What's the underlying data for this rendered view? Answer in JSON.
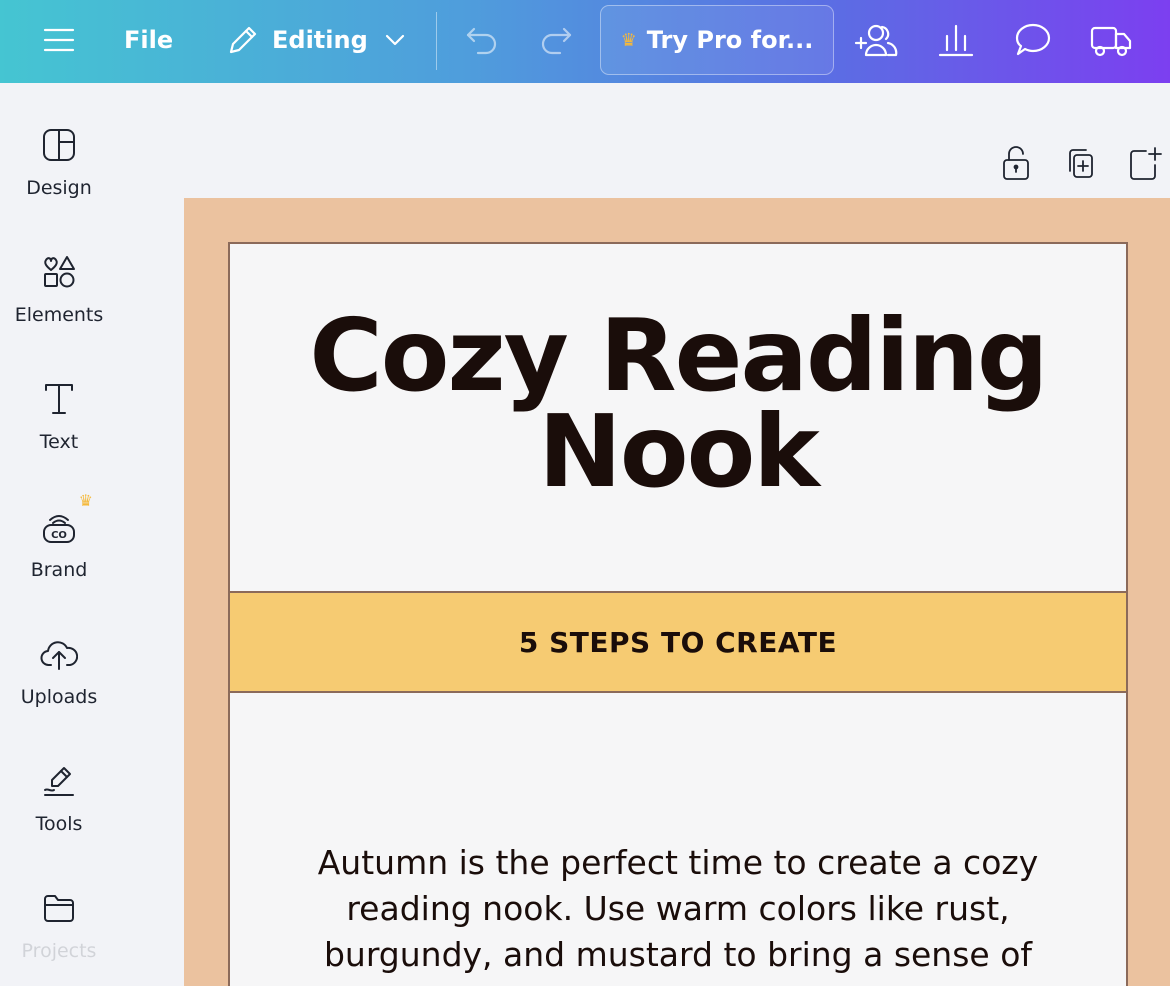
{
  "topbar": {
    "file_label": "File",
    "mode_label": "Editing",
    "try_pro_label": "Try Pro for..."
  },
  "sidebar": {
    "items": [
      {
        "label": "Design",
        "icon": "design-layout-icon"
      },
      {
        "label": "Elements",
        "icon": "shapes-icon"
      },
      {
        "label": "Text",
        "icon": "text-icon"
      },
      {
        "label": "Brand",
        "icon": "brand-kit-icon"
      },
      {
        "label": "Uploads",
        "icon": "cloud-upload-icon"
      },
      {
        "label": "Tools",
        "icon": "pen-tool-icon"
      },
      {
        "label": "Projects",
        "icon": "folder-icon"
      }
    ]
  },
  "canvas": {
    "title_line1": "Cozy Reading",
    "title_line2": "Nook",
    "banner": "5 STEPS TO CREATE",
    "body_line1": "Autumn is the perfect time to create a cozy",
    "body_line2": "reading nook. Use warm colors like rust,",
    "body_line3": "burgundy, and mustard to bring a sense of"
  },
  "colors": {
    "frame": "#ebc29f",
    "banner": "#f6cb72",
    "title_text": "#1a0d0a",
    "crown": "#f5b93b"
  }
}
